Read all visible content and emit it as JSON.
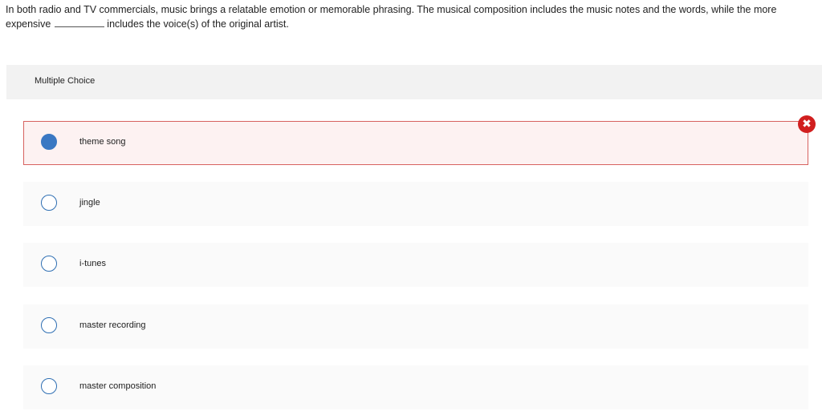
{
  "question": {
    "text_before": "In both radio and TV commercials, music brings a relatable emotion or memorable phrasing. The musical composition includes the music notes and the words, while the more expensive",
    "text_after": "includes the voice(s) of the original artist."
  },
  "panel": {
    "title": "Multiple Choice"
  },
  "options": [
    {
      "label": "theme song",
      "selected": true,
      "status": "incorrect"
    },
    {
      "label": "jingle",
      "selected": false
    },
    {
      "label": "i-tunes",
      "selected": false
    },
    {
      "label": "master recording",
      "selected": false
    },
    {
      "label": "master composition",
      "selected": false
    }
  ],
  "feedback": {
    "icon": "x-circle-icon",
    "glyph": "✖",
    "color": "#d11f1f"
  }
}
